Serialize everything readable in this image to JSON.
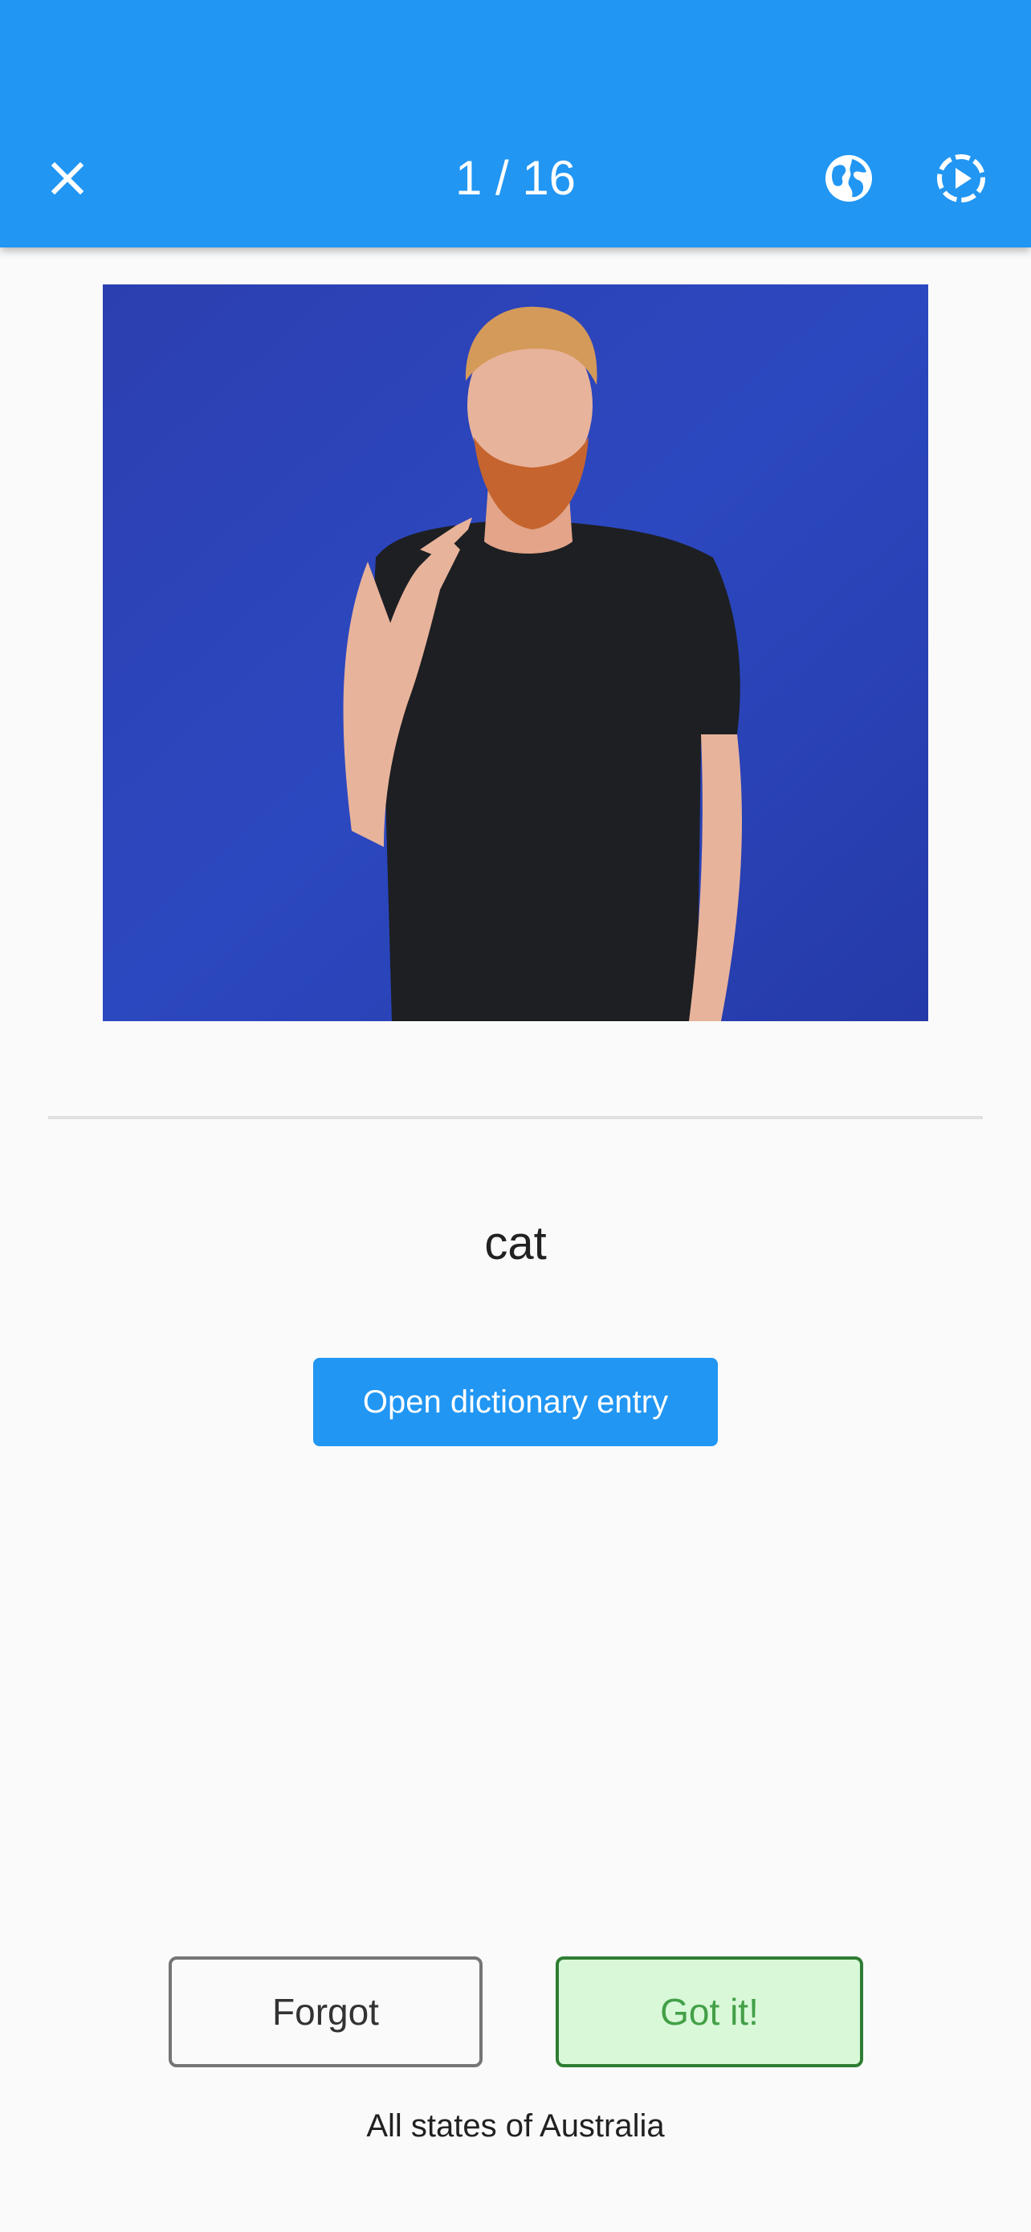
{
  "header": {
    "counter": "1 / 16",
    "close_icon": "close-icon",
    "globe_icon": "globe-icon",
    "play_icon": "play-circle-dashed-icon",
    "background": "#2196f3"
  },
  "media": {
    "subject": "person signing against blue backdrop",
    "background": "#2b44b8"
  },
  "card": {
    "word": "cat",
    "dictionary_button": "Open dictionary entry"
  },
  "actions": {
    "forgot_label": "Forgot",
    "got_it_label": "Got it!",
    "got_it_color": "#43a047"
  },
  "footer": {
    "region": "All states of Australia"
  }
}
